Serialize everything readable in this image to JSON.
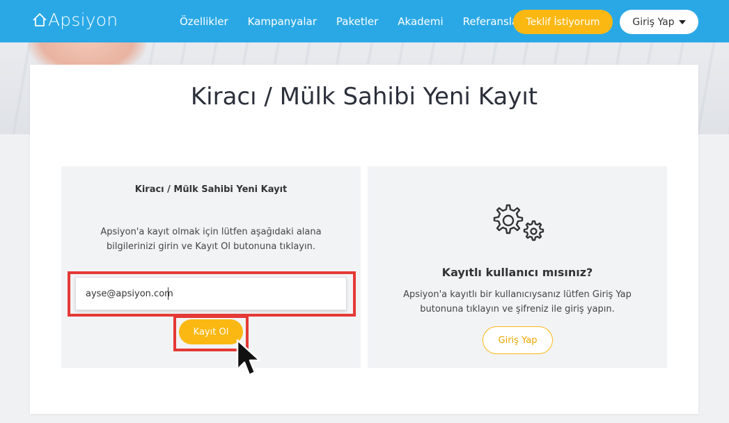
{
  "header": {
    "logo_text": "Apsiyon",
    "nav": [
      "Özellikler",
      "Kampanyalar",
      "Paketler",
      "Akademi",
      "Referanslar"
    ],
    "offer_button": "Teklif İstiyorum",
    "login_button": "Giriş Yap"
  },
  "page": {
    "title": "Kiracı / Mülk Sahibi Yeni Kayıt"
  },
  "left_panel": {
    "heading": "Kiracı / Mülk Sahibi Yeni Kayıt",
    "instruction_line1": "Apsiyon'a kayıt olmak için lütfen aşağıdaki alana",
    "instruction_line2": "bilgilerinizi girin ve Kayıt Ol butonuna tıklayın.",
    "email_value": "ayse@apsiyon.com",
    "register_button": "Kayıt Ol"
  },
  "right_panel": {
    "heading": "Kayıtlı kullanıcı mısınız?",
    "text_line1": "Apsiyon'a kayıtlı bir kullanıcıysanız lütfen Giriş Yap",
    "text_line2": "butonuna tıklayın ve şifreniz ile giriş yapın.",
    "login_button": "Giriş Yap",
    "icon": "gears-icon"
  },
  "colors": {
    "header_bg": "#2aa8e6",
    "accent": "#fbb813",
    "highlight": "#e53935"
  }
}
